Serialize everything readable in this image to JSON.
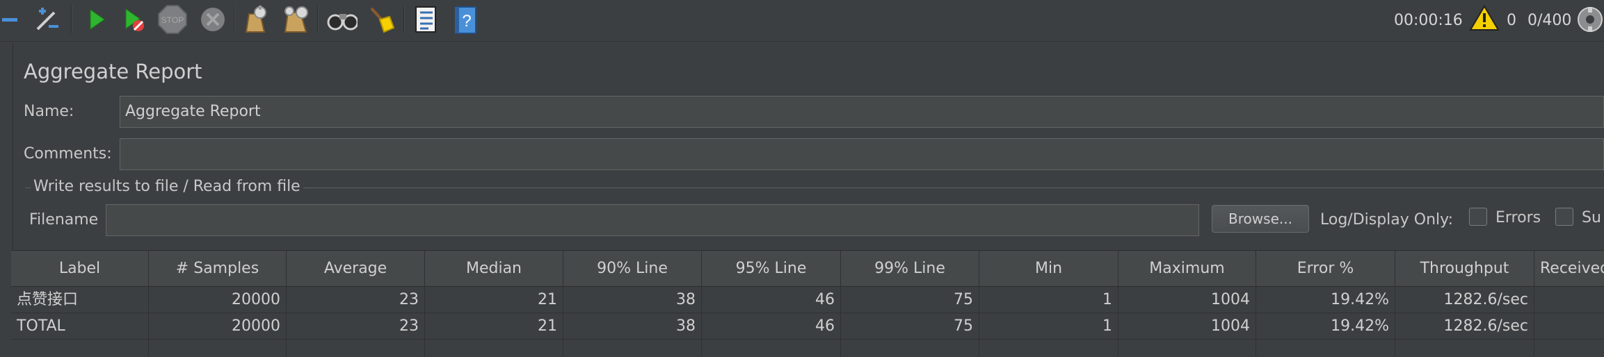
{
  "toolbar": {
    "icons": [
      {
        "name": "collapse-icon"
      },
      {
        "name": "toggle-icon"
      },
      {
        "name": "start-icon"
      },
      {
        "name": "start-no-pauses-icon"
      },
      {
        "name": "stop-icon"
      },
      {
        "name": "shutdown-icon"
      },
      {
        "name": "clear-icon"
      },
      {
        "name": "clear-all-icon"
      },
      {
        "name": "search-icon"
      },
      {
        "name": "reset-search-icon"
      },
      {
        "name": "function-helper-icon"
      },
      {
        "name": "help-icon"
      }
    ],
    "stop_label": "STOP",
    "elapsed_time": "00:00:16",
    "warning_count": "0",
    "threads": "0/400",
    "colors": {
      "start": "#2fb52f",
      "warning": "#f5d000"
    }
  },
  "panel": {
    "title": "Aggregate Report",
    "name_label": "Name:",
    "name_value": "Aggregate Report",
    "comments_label": "Comments:",
    "comments_value": "",
    "file_group_title": "Write results to file / Read from file",
    "filename_label": "Filename",
    "filename_value": "",
    "browse_label": "Browse...",
    "log_display_label": "Log/Display Only:",
    "errors_label": "Errors",
    "success_label": "Su"
  },
  "table": {
    "headers": [
      "Label",
      "# Samples",
      "Average",
      "Median",
      "90% Line",
      "95% Line",
      "99% Line",
      "Min",
      "Maximum",
      "Error %",
      "Throughput",
      "Received"
    ],
    "rows": [
      [
        "点赞接口",
        "20000",
        "23",
        "21",
        "38",
        "46",
        "75",
        "1",
        "1004",
        "19.42%",
        "1282.6/sec",
        ""
      ],
      [
        "TOTAL",
        "20000",
        "23",
        "21",
        "38",
        "46",
        "75",
        "1",
        "1004",
        "19.42%",
        "1282.6/sec",
        ""
      ]
    ]
  }
}
